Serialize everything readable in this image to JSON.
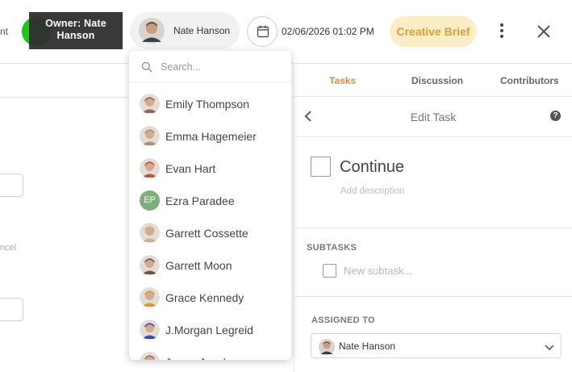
{
  "header": {
    "cut_left_text": "nt",
    "owner_tooltip": "Owner: Nate Hanson",
    "owner_name": "Nate Hanson",
    "datetime": "02/06/2026 01:02 PM",
    "project_chip": "Creative Brief"
  },
  "left_panel": {
    "cancel_text": "ncel"
  },
  "right_panel": {
    "tabs": [
      {
        "label": "Tasks",
        "active": true
      },
      {
        "label": "Discussion",
        "active": false
      },
      {
        "label": "Contributors",
        "active": false
      }
    ],
    "edit_title": "Edit Task",
    "help_glyph": "?",
    "task_title": "Continue",
    "task_description_placeholder": "Add description",
    "subtasks_label": "SUBTASKS",
    "subtask_placeholder": "New subtask...",
    "assigned_label": "ASSIGNED TO",
    "assigned_name": "Nate Hanson"
  },
  "dropdown": {
    "search_placeholder": "Search...",
    "users": [
      {
        "name": "Emily Thompson",
        "avatar_color": "#8a6a55"
      },
      {
        "name": "Emma Hagemeier",
        "avatar_color": "#b08f7a"
      },
      {
        "name": "Evan Hart",
        "avatar_color": "#b35a3a"
      },
      {
        "name": "Ezra Paradee",
        "initials": "EP",
        "avatar_color": "#7fae7d"
      },
      {
        "name": "Garrett Cossette",
        "avatar_color": "#c9b29c"
      },
      {
        "name": "Garrett Moon",
        "avatar_color": "#6b5545"
      },
      {
        "name": "Grace Kennedy",
        "avatar_color": "#d69a3a"
      },
      {
        "name": "J.Morgan Legreid",
        "avatar_color": "#3a4fa8"
      },
      {
        "name": "Jenna Jacobs",
        "avatar_color": "#9c6f5c"
      }
    ]
  },
  "colors": {
    "accent_tab": "#d98a56",
    "brief_bg": "#fbeec6",
    "brief_text": "#d9a137",
    "status_green": "#22c51f"
  }
}
